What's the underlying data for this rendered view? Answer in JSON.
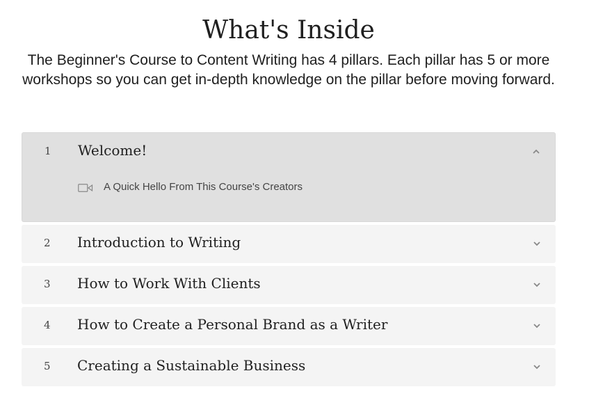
{
  "header": {
    "title": "What's Inside",
    "intro": "The Beginner's Course to Content Writing has 4 pillars. Each pillar has 5 or more workshops so you can get in-depth knowledge on the pillar before moving forward."
  },
  "sections": [
    {
      "number": "1",
      "title": "Welcome!",
      "expanded": true,
      "chevron": "chevron-up-icon",
      "lessons": [
        {
          "icon": "video-icon",
          "title": "A Quick Hello From This Course's Creators"
        }
      ]
    },
    {
      "number": "2",
      "title": "Introduction to Writing",
      "expanded": false,
      "chevron": "chevron-down-icon"
    },
    {
      "number": "3",
      "title": "How to Work With Clients",
      "expanded": false,
      "chevron": "chevron-down-icon"
    },
    {
      "number": "4",
      "title": "How to Create a Personal Brand as a Writer",
      "expanded": false,
      "chevron": "chevron-down-icon"
    },
    {
      "number": "5",
      "title": "Creating a Sustainable Business",
      "expanded": false,
      "chevron": "chevron-down-icon"
    }
  ],
  "colors": {
    "open_section_bg": "#e0e0e0",
    "closed_section_bg": "#f4f4f4",
    "text": "#1f1f1f",
    "muted": "#888888"
  }
}
